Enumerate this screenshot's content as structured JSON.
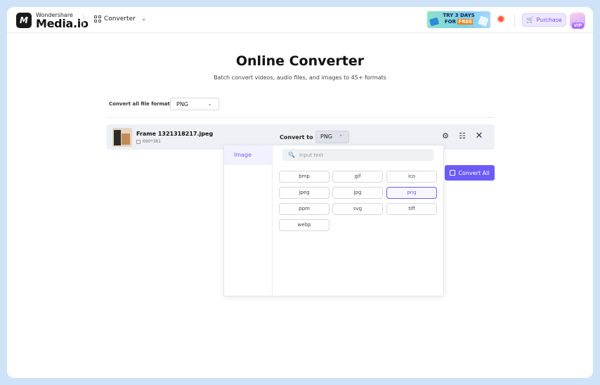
{
  "header": {
    "brand_small": "Wondershare",
    "brand_main": "Media.io",
    "logo_mark": "M",
    "nav_converter": "Converter",
    "trial_line1": "TRY 3 DAYS",
    "trial_line2_prefix": "FOR",
    "trial_line2_free": "FREE",
    "purchase_label": "Purchase",
    "vip_label": "VIP"
  },
  "main": {
    "title": "Online Converter",
    "subtitle": "Batch convert videos, audio files, and images to 45+ formats",
    "format_all_label": "Convert all file format to:",
    "format_all_value": "PNG",
    "convert_all_label": "Convert All"
  },
  "file": {
    "name": "Frame 1321318217.jpeg",
    "dims": "690*381",
    "convert_to_label": "Convert to",
    "convert_to_value": "PNG"
  },
  "dropdown": {
    "category": "Image",
    "search_placeholder": "Input text",
    "formats": [
      "bmp",
      "gif",
      "ico",
      "jpeg",
      "jpg",
      "png",
      "ppm",
      "svg",
      "tiff",
      "webp"
    ],
    "selected": "png"
  },
  "colors": {
    "accent": "#6c5cf7",
    "background": "#cfe3f8"
  },
  "icons": [
    "grid-icon",
    "chevron-down-icon",
    "cart-icon",
    "settings-icon",
    "edit-icon",
    "close-icon",
    "search-icon",
    "convert-icon"
  ]
}
